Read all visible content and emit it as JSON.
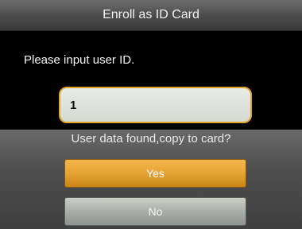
{
  "window": {
    "title": "Enroll as ID Card"
  },
  "form": {
    "prompt": "Please input user ID.",
    "user_id_value": "1"
  },
  "dialog": {
    "message": "User data found,copy to card?",
    "yes_label": "Yes",
    "no_label": "No"
  },
  "colors": {
    "accent": "#e7a436",
    "input_border": "#e0a426",
    "background": "#000000"
  }
}
